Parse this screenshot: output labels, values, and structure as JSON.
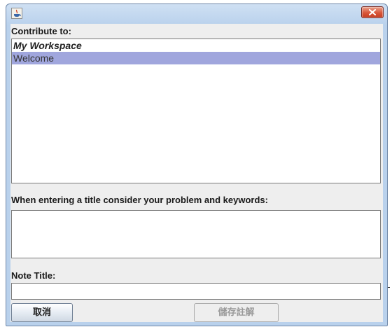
{
  "window": {
    "icon": "java-cup-icon",
    "close_icon": "close-x-icon",
    "accent_close": "#d9573a"
  },
  "contribute": {
    "label": "Contribute to:",
    "items": [
      {
        "label": "My Workspace",
        "type": "header"
      },
      {
        "label": "Welcome",
        "type": "selected"
      }
    ],
    "selection_color": "#a0a6dd"
  },
  "hint": {
    "label": "When entering a title consider your problem and keywords:",
    "value": ""
  },
  "note_title": {
    "label": "Note Title:",
    "value": ""
  },
  "buttons": {
    "cancel_label": "取消",
    "save_label": "儲存註解",
    "save_enabled": false
  }
}
